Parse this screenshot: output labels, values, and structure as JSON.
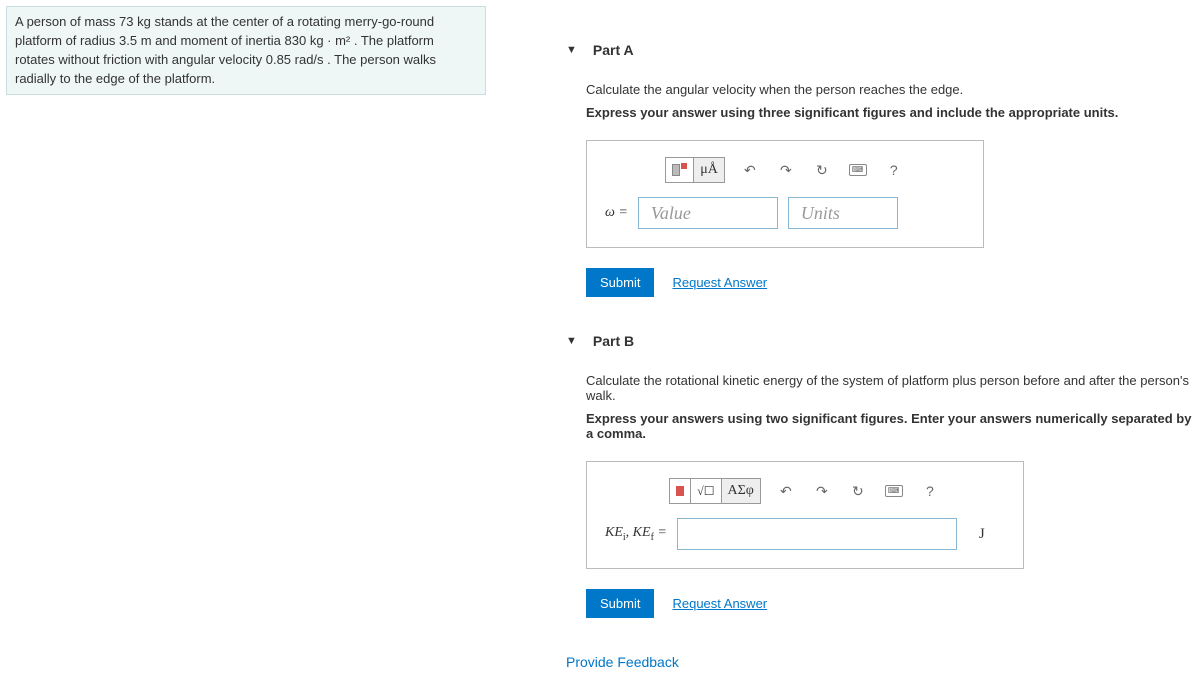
{
  "problem": {
    "text": "A person of mass 73 kg stands at the center of a rotating merry-go-round platform of radius 3.5 m and moment of inertia 830 kg · m² . The platform rotates without friction with angular velocity 0.85 rad/s . The person walks radially to the edge of the platform."
  },
  "partA": {
    "title": "Part A",
    "prompt": "Calculate the angular velocity when the person reaches the edge.",
    "instruction": "Express your answer using three significant figures and include the appropriate units.",
    "var_label": "ω =",
    "value_placeholder": "Value",
    "units_placeholder": "Units",
    "units_tool": "μÅ",
    "help": "?",
    "submit": "Submit",
    "request": "Request Answer"
  },
  "partB": {
    "title": "Part B",
    "prompt": "Calculate the rotational kinetic energy of the system of platform plus person before and after the person's walk.",
    "instruction": "Express your answers using two significant figures. Enter your answers numerically separated by a comma.",
    "var_label_html": "KEᵢ, KE_f =",
    "sigma_tool": "ΑΣφ",
    "unit_suffix": "J",
    "help": "?",
    "submit": "Submit",
    "request": "Request Answer"
  },
  "feedback": "Provide Feedback"
}
